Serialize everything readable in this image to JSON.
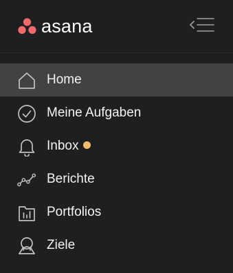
{
  "app": {
    "logo_text": "asana",
    "brand_color": "#f06a6a"
  },
  "header": {
    "collapse_icon": "sidebar-collapse-icon"
  },
  "nav": {
    "active_item": "Home",
    "items": [
      {
        "label": "Home",
        "icon": "home-icon"
      },
      {
        "label": "Meine Aufgaben",
        "icon": "check-circle-icon"
      },
      {
        "label": "Inbox",
        "icon": "bell-icon",
        "badge_color": "#f1bd6c"
      },
      {
        "label": "Berichte",
        "icon": "line-chart-icon"
      },
      {
        "label": "Portfolios",
        "icon": "portfolio-folder-icon"
      },
      {
        "label": "Ziele",
        "icon": "goal-person-icon"
      }
    ]
  }
}
